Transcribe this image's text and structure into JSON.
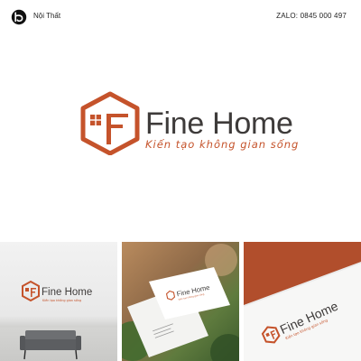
{
  "header": {
    "brand_label": "Nội Thất",
    "contact": "ZALO: 0845 000 497"
  },
  "logo": {
    "name": "Fine Home",
    "tagline": "Kiến tạo không gian sống",
    "brand_color": "#c5532b",
    "text_color": "#3e3b3a"
  },
  "mockups": {
    "wall_sign": {
      "name": "Fine Home",
      "tagline": "Kiến tạo không gian sống"
    },
    "business_card": {
      "name": "Fine Home",
      "tagline": "Kiến tạo không gian sống"
    },
    "letterhead": {
      "name": "Fine Home",
      "tagline": "Kiến tạo không gian sống"
    }
  }
}
